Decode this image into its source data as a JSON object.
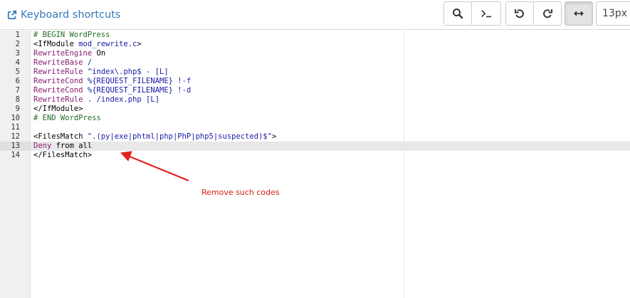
{
  "toolbar": {
    "keyboard_shortcuts_label": "Keyboard shortcuts",
    "font_size_value": "13px"
  },
  "editor": {
    "line_numbers": [
      "1",
      "2",
      "3",
      "4",
      "5",
      "6",
      "7",
      "8",
      "9",
      "10",
      "11",
      "12",
      "13",
      "14"
    ],
    "active_line": "13",
    "lines": [
      [
        {
          "t": "# BEGIN WordPress",
          "c": "comment"
        }
      ],
      [
        {
          "t": "<IfModule ",
          "c": "tag"
        },
        {
          "t": "mod_rewrite.c",
          "c": "string"
        },
        {
          "t": ">",
          "c": "tag"
        }
      ],
      [
        {
          "t": "RewriteEngine",
          "c": "keyword"
        },
        {
          "t": " On",
          "c": "plain"
        }
      ],
      [
        {
          "t": "RewriteBase",
          "c": "keyword"
        },
        {
          "t": " /",
          "c": "string"
        }
      ],
      [
        {
          "t": "RewriteRule",
          "c": "keyword"
        },
        {
          "t": " ^index\\.php$ - [L]",
          "c": "string"
        }
      ],
      [
        {
          "t": "RewriteCond",
          "c": "keyword"
        },
        {
          "t": " %{REQUEST_FILENAME} !-f",
          "c": "string"
        }
      ],
      [
        {
          "t": "RewriteCond",
          "c": "keyword"
        },
        {
          "t": " %{REQUEST_FILENAME} !-d",
          "c": "string"
        }
      ],
      [
        {
          "t": "RewriteRule",
          "c": "keyword"
        },
        {
          "t": " . /index.php [L]",
          "c": "string"
        }
      ],
      [
        {
          "t": "</IfModule>",
          "c": "tag"
        }
      ],
      [
        {
          "t": "# END WordPress",
          "c": "comment"
        }
      ],
      [],
      [
        {
          "t": "<FilesMatch ",
          "c": "tag"
        },
        {
          "t": "\".(py|exe|phtml|php|PhP|php5|suspected)$\"",
          "c": "string"
        },
        {
          "t": ">",
          "c": "tag"
        }
      ],
      [
        {
          "t": "Deny",
          "c": "keyword"
        },
        {
          "t": " from all",
          "c": "plain"
        }
      ],
      [
        {
          "t": "</FilesMatch>",
          "c": "tag"
        }
      ]
    ]
  },
  "annotation": {
    "text": "Remove such codes",
    "color": "#d41d16"
  },
  "colors": {
    "link": "#3479b8",
    "comment": "#236e24",
    "keyword": "#8b1c74",
    "string": "#1a1aa6"
  },
  "icons": [
    "external-link-icon",
    "search-icon",
    "terminal-icon",
    "undo-icon",
    "redo-icon",
    "wrap-arrows-icon",
    "chevron-down-icon"
  ]
}
